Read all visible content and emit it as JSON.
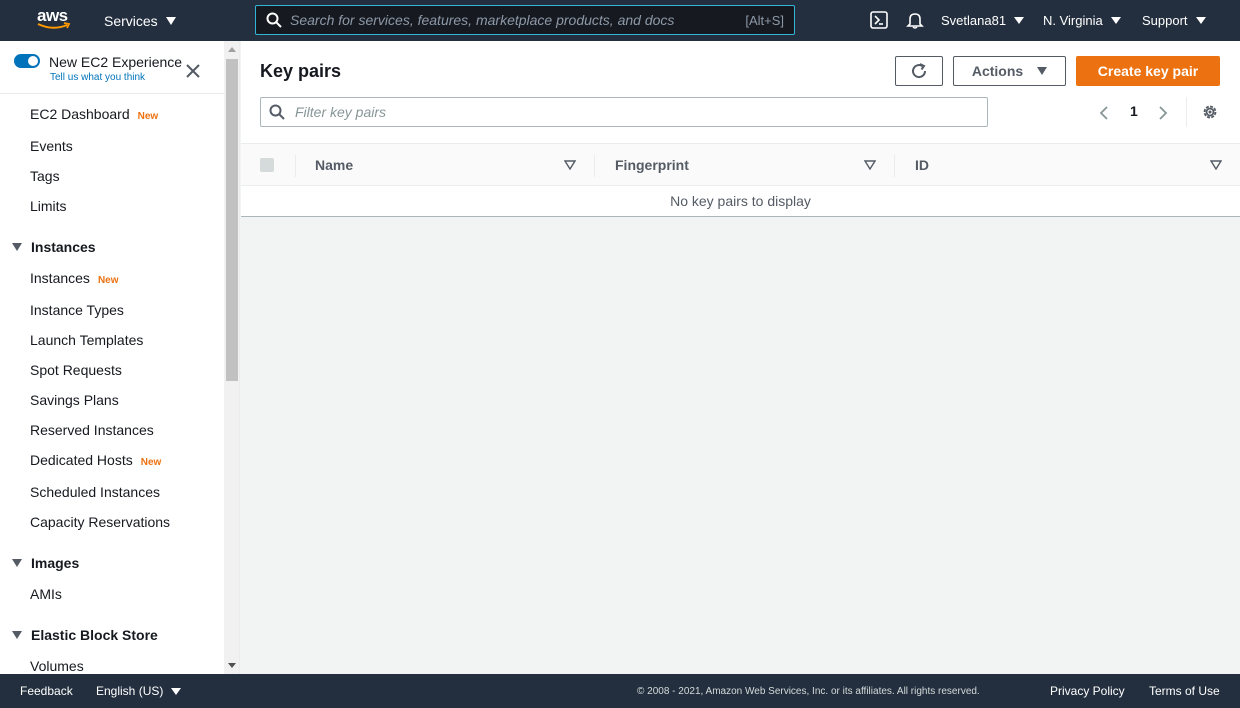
{
  "topnav": {
    "logo": "aws",
    "services": "Services",
    "search_placeholder": "Search for services, features, marketplace products, and docs",
    "search_shortcut": "[Alt+S]",
    "user": "Svetlana81",
    "region": "N. Virginia",
    "support": "Support"
  },
  "sidebar": {
    "toggle_title": "New EC2 Experience",
    "toggle_sub": "Tell us what you think",
    "new_badge": "New",
    "items": [
      {
        "label": "EC2 Dashboard",
        "badge": "New"
      },
      {
        "label": "Events"
      },
      {
        "label": "Tags"
      },
      {
        "label": "Limits"
      }
    ],
    "sections": [
      {
        "label": "Instances",
        "items": [
          "Instances",
          "Instance Types",
          "Launch Templates",
          "Spot Requests",
          "Savings Plans",
          "Reserved Instances",
          "Dedicated Hosts",
          "Scheduled Instances",
          "Capacity Reservations"
        ]
      },
      {
        "label": "Images",
        "items": [
          "AMIs"
        ]
      },
      {
        "label": "Elastic Block Store",
        "items": [
          "Volumes"
        ]
      }
    ]
  },
  "main": {
    "title": "Key pairs",
    "actions_label": "Actions",
    "create_label": "Create key pair",
    "filter_placeholder": "Filter key pairs",
    "page_number": "1",
    "columns": [
      "Name",
      "Fingerprint",
      "ID"
    ],
    "empty_message": "No key pairs to display"
  },
  "footer": {
    "feedback": "Feedback",
    "language": "English (US)",
    "copyright": "© 2008 - 2021, Amazon Web Services, Inc. or its affiliates. All rights reserved.",
    "privacy": "Privacy Policy",
    "terms": "Terms of Use"
  },
  "colors": {
    "nav_bg": "#232f3e",
    "accent": "#ec7211",
    "link": "#0073bb"
  }
}
